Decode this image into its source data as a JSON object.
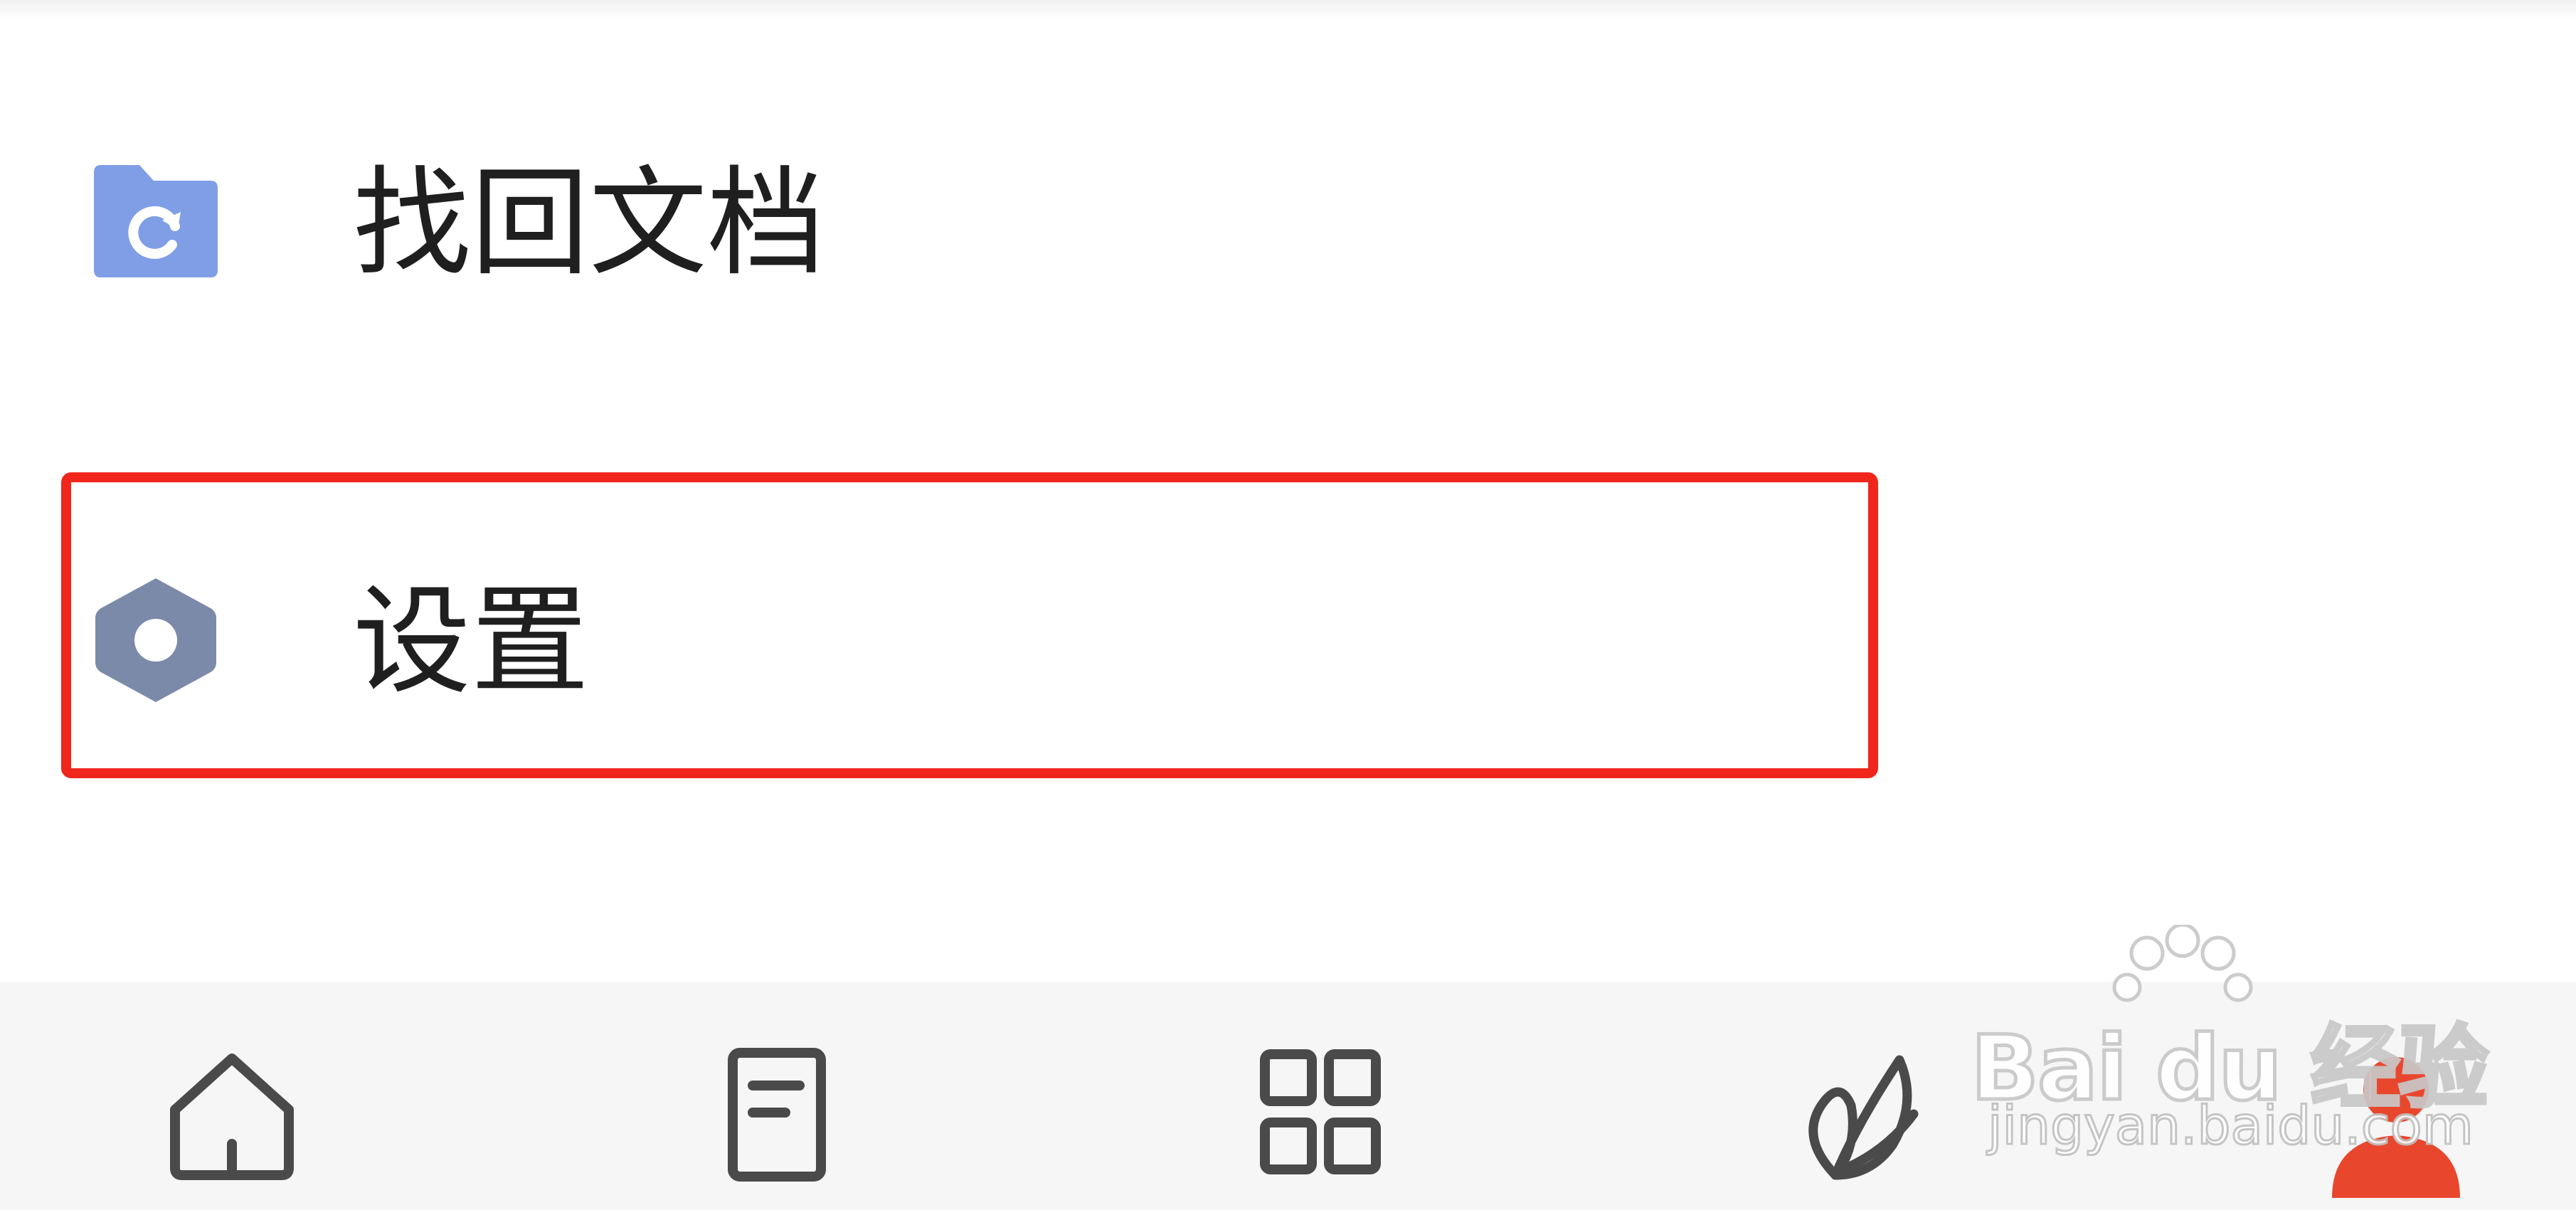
{
  "menu": {
    "items": [
      {
        "label": "找回文档",
        "icon": "folder-restore-icon",
        "color": "#7f9ee6"
      },
      {
        "label": "设置",
        "icon": "hexagon-settings-icon",
        "color": "#7b8aa8",
        "highlighted": true
      }
    ]
  },
  "highlight_color": "#f0261d",
  "tabbar": {
    "tabs": [
      {
        "icon": "home-icon"
      },
      {
        "icon": "document-icon"
      },
      {
        "icon": "apps-grid-icon"
      },
      {
        "icon": "leaf-icon"
      },
      {
        "icon": "user-icon",
        "active": true,
        "color": "#e8472e"
      }
    ]
  },
  "watermark": {
    "brand": "Bai du 经验",
    "site": "jingyan.baidu.com"
  }
}
